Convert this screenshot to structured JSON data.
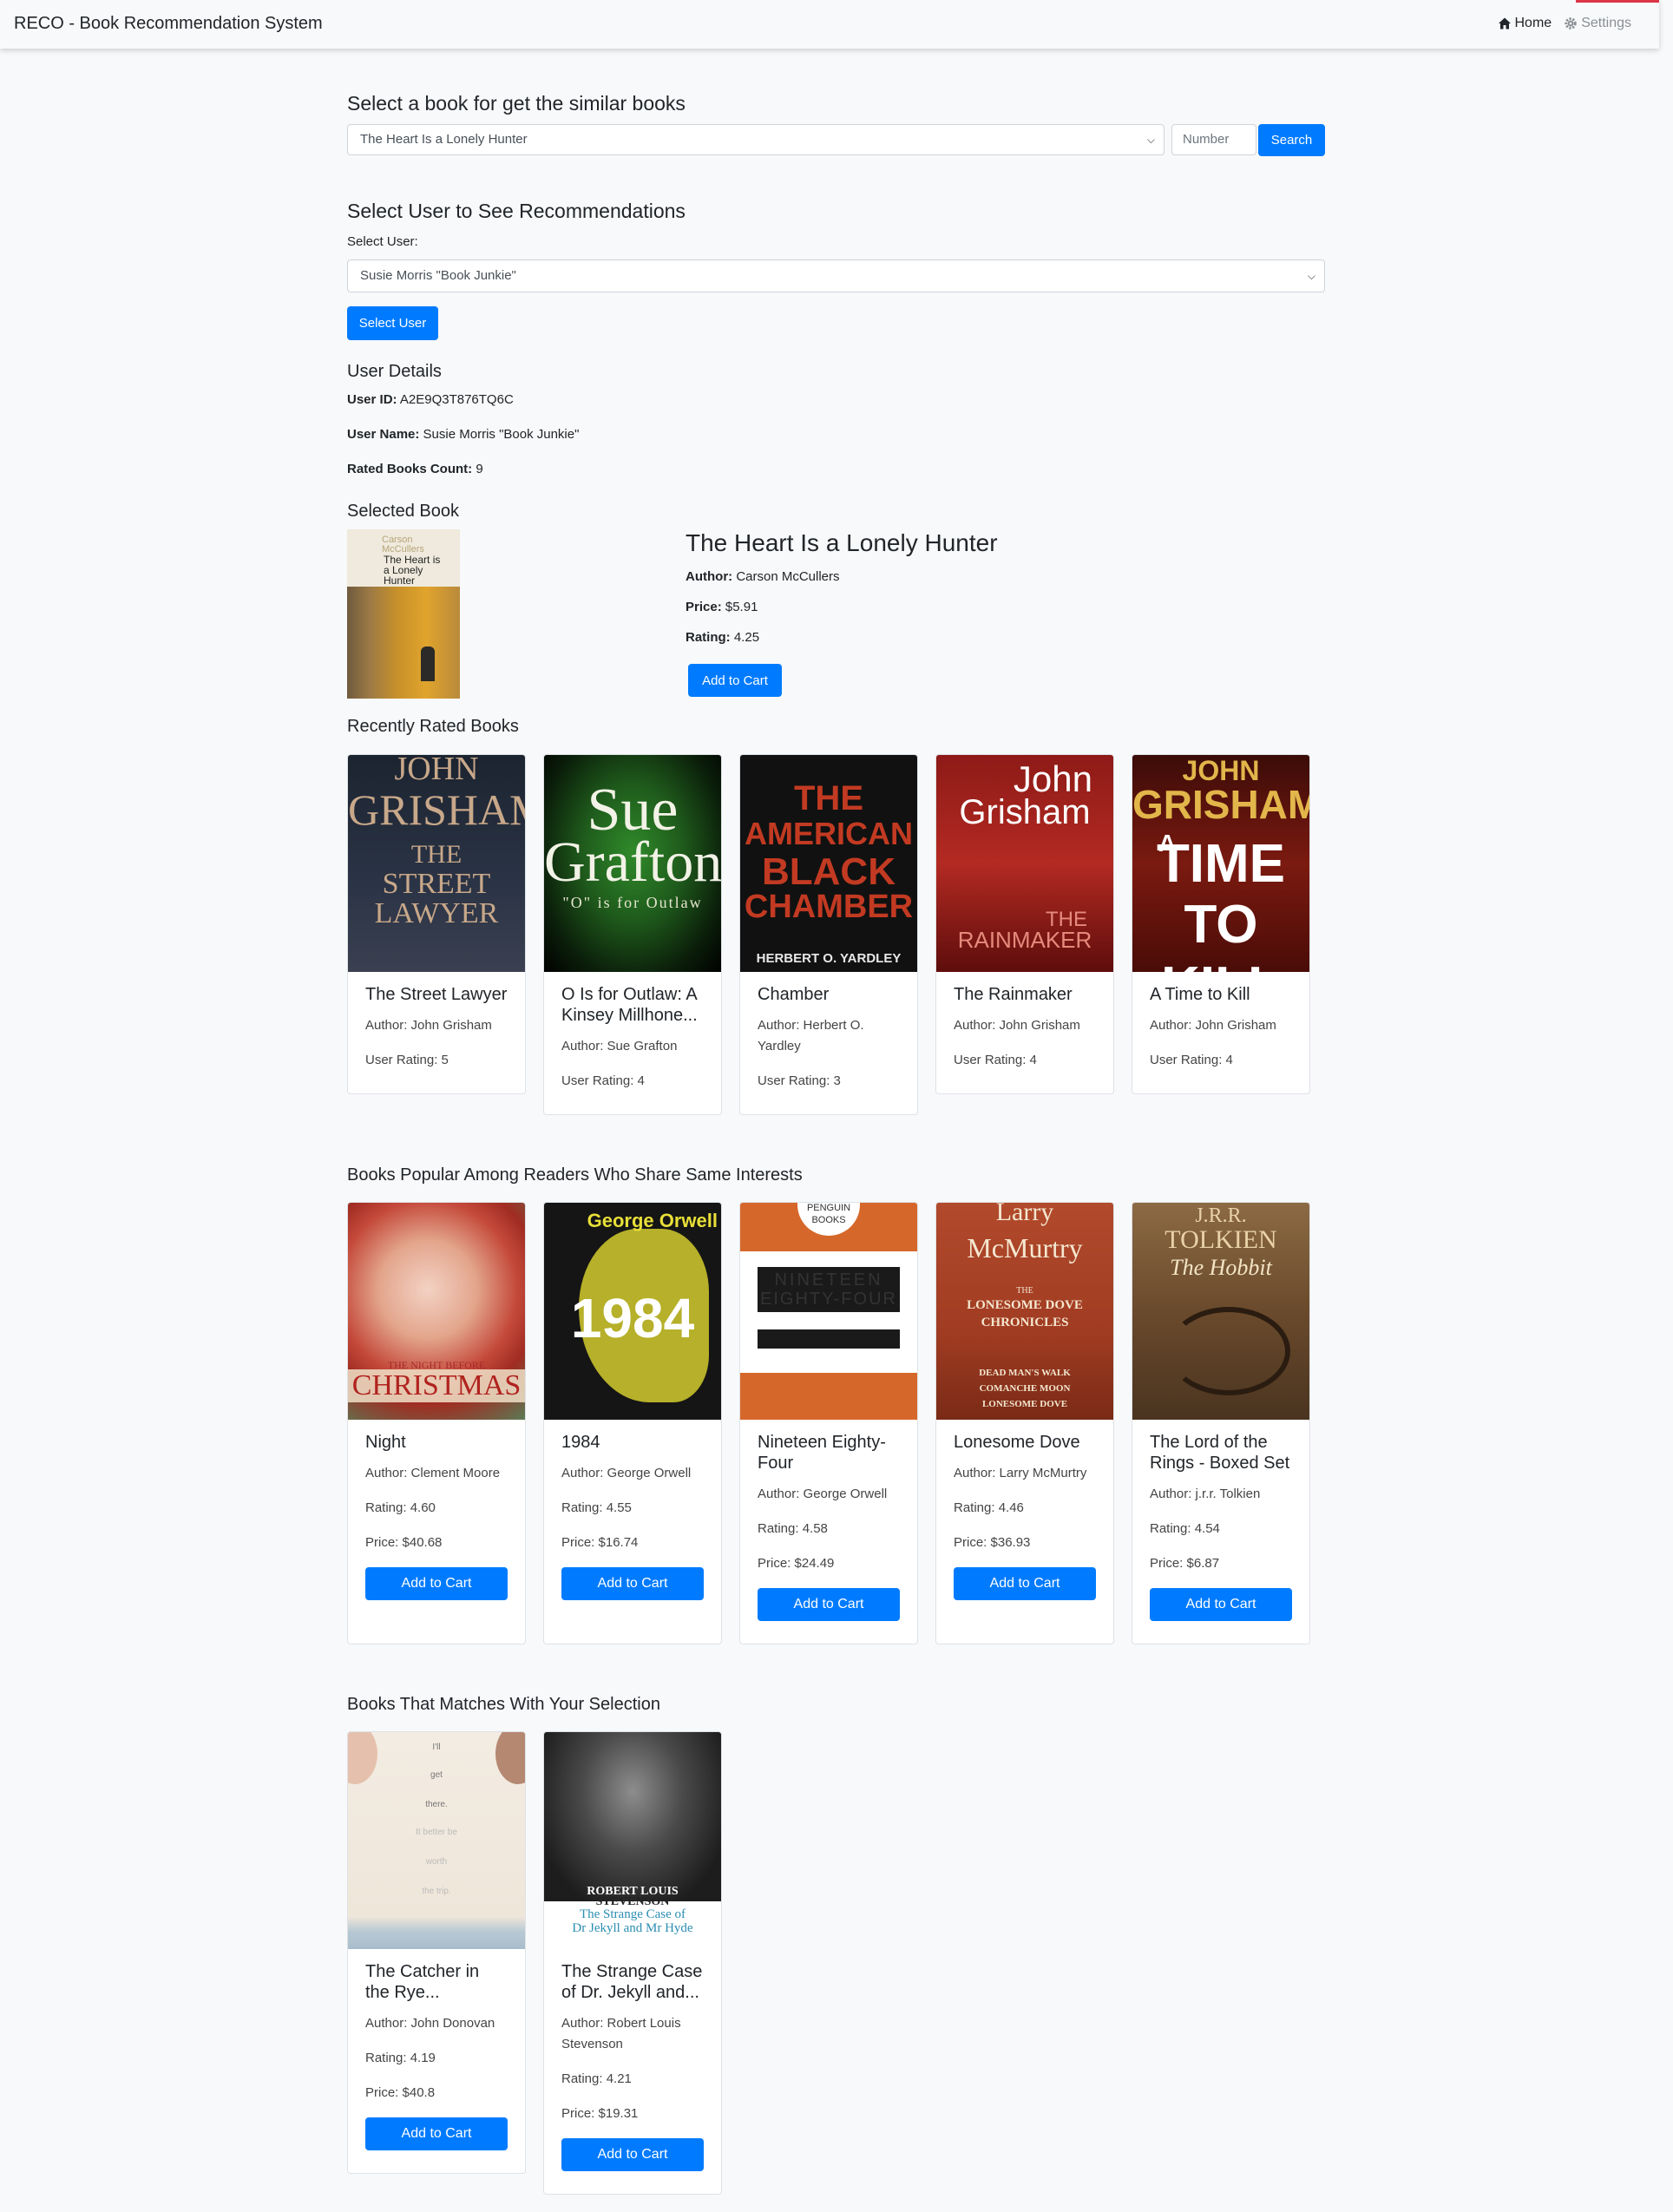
{
  "nav": {
    "brand": "RECO - Book Recommendation System",
    "home_label": "Home",
    "settings_label": "Settings"
  },
  "similar": {
    "heading": "Select a book for get the similar books",
    "selected_book": "The Heart Is a Lonely Hunter",
    "number_placeholder": "Number",
    "search_label": "Search"
  },
  "user_select": {
    "heading": "Select User to See Recommendations",
    "label": "Select User:",
    "selected_user": "Susie Morris \"Book Junkie\"",
    "button_label": "Select User"
  },
  "user_details": {
    "heading": "User Details",
    "user_id_label": "User ID:",
    "user_id": "A2E9Q3T876TQ6C",
    "user_name_label": "User Name:",
    "user_name": "Susie Morris \"Book Junkie\"",
    "rated_count_label": "Rated Books Count:",
    "rated_count": "9"
  },
  "selected_book": {
    "heading": "Selected Book",
    "title": "The Heart Is a Lonely Hunter",
    "author_label": "Author:",
    "author": "Carson McCullers",
    "price_label": "Price:",
    "price": "$5.91",
    "rating_label": "Rating:",
    "rating": "4.25",
    "cart_label": "Add to Cart",
    "cover_lines": [
      "Carson",
      "McCullers",
      "The Heart is",
      "a Lonely",
      "Hunter"
    ]
  },
  "recent": {
    "heading": "Recently Rated Books",
    "books": [
      {
        "title": "The Street Lawyer",
        "author": "Author: John Grisham",
        "rating": "User Rating: 5",
        "cover": [
          "JOHN",
          "GRISHAM",
          "THE",
          "STREET",
          "LAWYER"
        ]
      },
      {
        "title": "O Is for Outlaw: A Kinsey Millhone...",
        "author": "Author: Sue Grafton",
        "rating": "User Rating: 4",
        "cover": [
          "Sue",
          "Grafton",
          "\"O\" is for Outlaw"
        ]
      },
      {
        "title": "Chamber",
        "author": "Author: Herbert O. Yardley",
        "rating": "User Rating: 3",
        "cover": [
          "THE",
          "AMERICAN",
          "BLACK",
          "CHAMBER",
          "HERBERT O. YARDLEY"
        ]
      },
      {
        "title": "The Rainmaker",
        "author": "Author: John Grisham",
        "rating": "User Rating: 4",
        "cover": [
          "John",
          "Grisham",
          "THE",
          "RAINMAKER"
        ]
      },
      {
        "title": "A Time to Kill",
        "author": "Author: John Grisham",
        "rating": "User Rating: 4",
        "cover": [
          "JOHN",
          "GRISHAM",
          "A",
          "TIME",
          "TO KILL"
        ]
      }
    ]
  },
  "popular": {
    "heading": "Books Popular Among Readers Who Share Same Interests",
    "cart_label": "Add to Cart",
    "books": [
      {
        "title": "Night",
        "author": "Author: Clement Moore",
        "rating": "Rating: 4.60",
        "price": "Price: $40.68",
        "cover": [
          "THE NIGHT BEFORE",
          "CHRISTMAS"
        ]
      },
      {
        "title": "1984",
        "author": "Author: George Orwell",
        "rating": "Rating: 4.55",
        "price": "Price: $16.74",
        "cover": [
          "1984",
          "George Orwell"
        ]
      },
      {
        "title": "Nineteen Eighty-Four",
        "author": "Author: George Orwell",
        "rating": "Rating: 4.58",
        "price": "Price: $24.49",
        "cover": [
          "PENGUIN",
          "BOOKS",
          "NINETEEN",
          "EIGHTY-FOUR"
        ]
      },
      {
        "title": "Lonesome Dove",
        "author": "Author: Larry McMurtry",
        "rating": "Rating: 4.46",
        "price": "Price: $36.93",
        "cover": [
          "Larry",
          "McMurtry",
          "THE",
          "LONESOME DOVE",
          "CHRONICLES",
          "DEAD MAN'S WALK",
          "COMANCHE MOON",
          "LONESOME DOVE"
        ]
      },
      {
        "title": "The Lord of the Rings - Boxed Set",
        "author": "Author: j.r.r. Tolkien",
        "rating": "Rating: 4.54",
        "price": "Price: $6.87",
        "cover": [
          "J.R.R.",
          "TOLKIEN",
          "The Hobbit"
        ]
      }
    ]
  },
  "matches": {
    "heading": "Books That Matches With Your Selection",
    "cart_label": "Add to Cart",
    "books": [
      {
        "title": "The Catcher in the Rye...",
        "author": "Author: John Donovan",
        "rating": "Rating: 4.19",
        "price": "Price: $40.8",
        "cover": [
          "I'll",
          "get",
          "there.",
          "It better be",
          "worth",
          "the trip."
        ]
      },
      {
        "title": "The Strange Case of Dr. Jekyll and...",
        "author": "Author: Robert Louis Stevenson",
        "rating": "Rating: 4.21",
        "price": "Price: $19.31",
        "cover": [
          "ROBERT LOUIS",
          "STEVENSON",
          "The Strange Case of",
          "Dr Jekyll and Mr Hyde"
        ]
      }
    ]
  },
  "colors": {
    "primary": "#007bff",
    "navbar_bg": "#f8f9fa",
    "accent_red": "#dc3545"
  }
}
